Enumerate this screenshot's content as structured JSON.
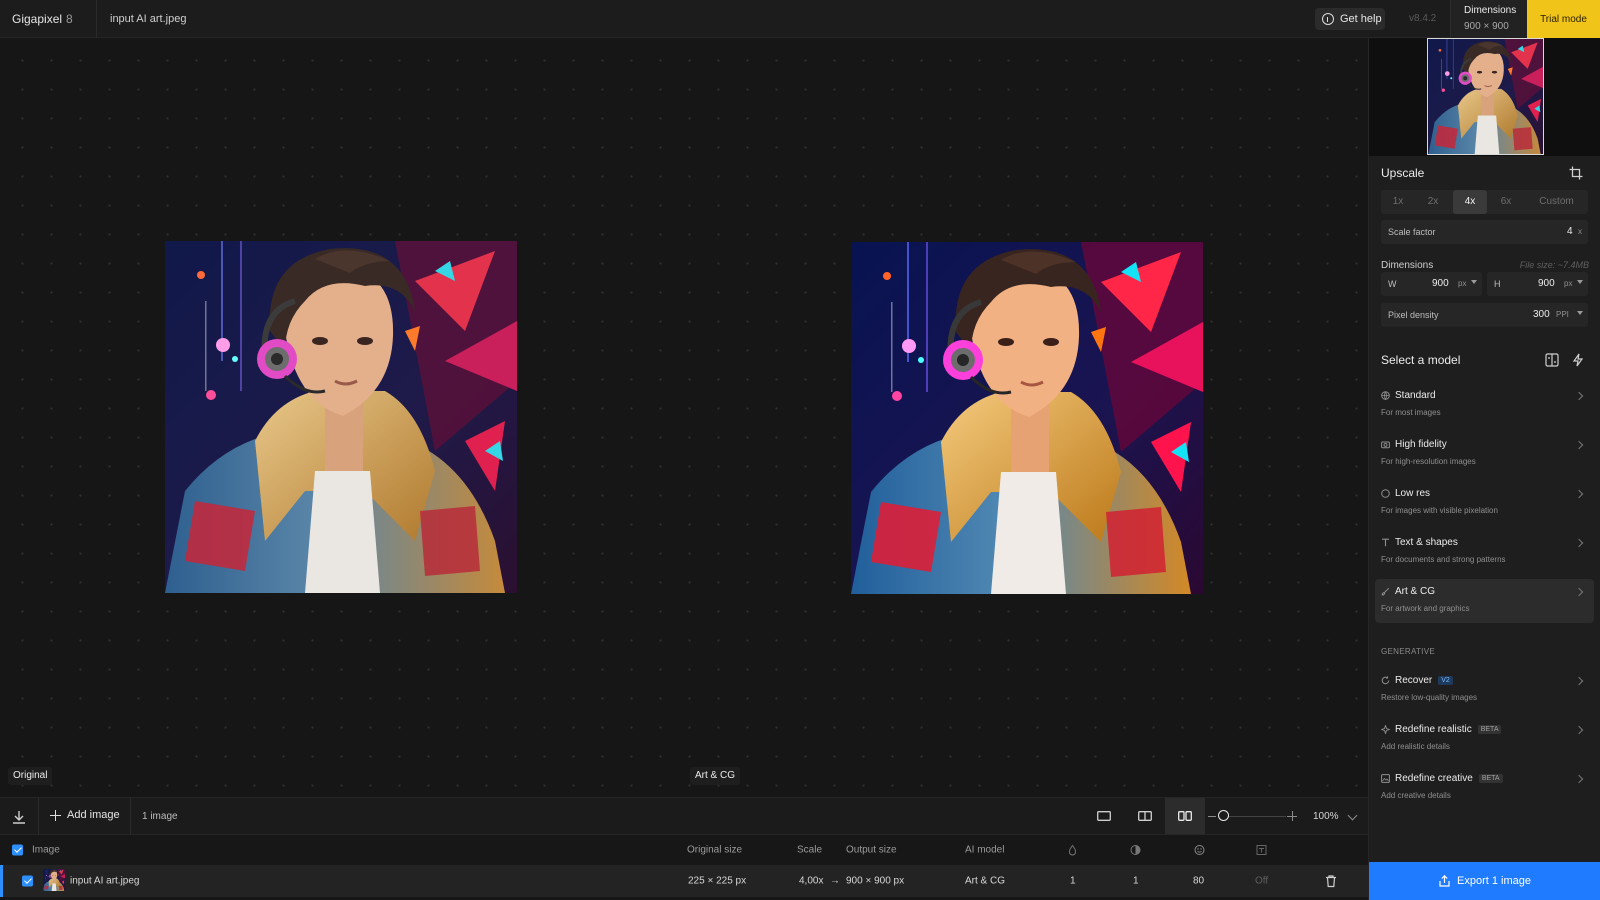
{
  "app": {
    "name": "Gigapixel",
    "version_major": "8",
    "file_title": "input AI art.jpeg"
  },
  "topbar": {
    "help_label": "Get help",
    "version": "v8.4.2",
    "dimensions_title": "Dimensions",
    "dimensions_value": "900 × 900",
    "trial_label": "Trial mode"
  },
  "canvas": {
    "left_label": "Original",
    "right_label": "Art & CG"
  },
  "toolbar": {
    "add_image_label": "Add image",
    "image_count": "1 image",
    "zoom": "100%"
  },
  "table": {
    "headers": {
      "image": "Image",
      "original_size": "Original size",
      "scale": "Scale",
      "output_size": "Output size",
      "ai_model": "AI model"
    },
    "row": {
      "name": "input AI art.jpeg",
      "original_size": "225 × 225 px",
      "scale": "4,00x",
      "arrow": "→",
      "output_size": "900 × 900 px",
      "ai_model": "Art & CG",
      "v1": "1",
      "v2": "1",
      "v3": "80",
      "v4": "Off"
    }
  },
  "panel": {
    "upscale_title": "Upscale",
    "scale_options": [
      "1x",
      "2x",
      "4x",
      "6x",
      "Custom"
    ],
    "scale_selected": "4x",
    "scale_factor_label": "Scale factor",
    "scale_factor_value": "4",
    "scale_factor_unit": "x",
    "dimensions_label": "Dimensions",
    "file_size": "File size: ~7.4MB",
    "width_label": "W",
    "width_value": "900",
    "height_label": "H",
    "height_value": "900",
    "px_unit": "px",
    "pixel_density_label": "Pixel density",
    "pixel_density_value": "300",
    "ppi_unit": "PPI",
    "select_model_title": "Select a model",
    "models": [
      {
        "name": "Standard",
        "desc": "For most images"
      },
      {
        "name": "High fidelity",
        "desc": "For high-resolution images"
      },
      {
        "name": "Low res",
        "desc": "For images with visible pixelation"
      },
      {
        "name": "Text & shapes",
        "desc": "For documents and strong patterns"
      },
      {
        "name": "Art & CG",
        "desc": "For artwork and graphics"
      }
    ],
    "generative_label": "GENERATIVE",
    "generative_models": [
      {
        "name": "Recover",
        "badge": "V2",
        "desc": "Restore low-quality images"
      },
      {
        "name": "Redefine realistic",
        "badge": "BETA",
        "desc": "Add realistic details"
      },
      {
        "name": "Redefine creative",
        "badge": "BETA",
        "desc": "Add creative details"
      }
    ],
    "export_label": "Export 1 image"
  },
  "colors": {
    "accent": "#1f7bff",
    "trial": "#f1c419",
    "panel": "#1e1e1e",
    "canvas": "#161616"
  }
}
